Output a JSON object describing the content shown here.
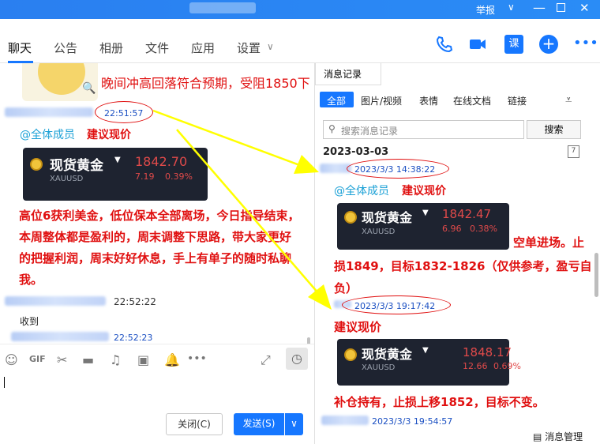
{
  "window": {
    "title": "",
    "report_label": "举报"
  },
  "tabs": [
    "聊天",
    "公告",
    "相册",
    "文件",
    "应用",
    "设置"
  ],
  "chat": {
    "top_caption": "晚间冲高回落符合预期，受阻1850下",
    "msg1_time": "22:51:57",
    "msg1_at": "@全体成员",
    "msg1_title": "建议现价",
    "card1": {
      "name": "现货黄金",
      "code": "XAUUSD",
      "price": "1842.70",
      "change": "7.19",
      "pct": "0.39%"
    },
    "msg1_body": "高位6获利美金，低位保本全部离场，今日指导结束，本周整体都是盈利的，周末调整下思路，带大家更好的把握利润，周末好好休息，手上有单子的随时私聊我。",
    "msg2_time": "22:52:22",
    "msg2_body": "收到",
    "msg3_time": "22:52:23"
  },
  "buttons": {
    "close": "关闭(C)",
    "send": "发送(S)"
  },
  "history": {
    "title": "消息记录",
    "filters": [
      "全部",
      "图片/视频",
      "表情",
      "在线文档",
      "链接"
    ],
    "search_placeholder": "搜索消息记录",
    "search_button": "搜索",
    "date": "2023-03-03",
    "entry1_time": "2023/3/3 14:38:22",
    "entry1_at": "@全体成员",
    "entry1_title": "建议现价",
    "card2": {
      "name": "现货黄金",
      "code": "XAUUSD",
      "price": "1842.47",
      "change": "6.96",
      "pct": "0.38%"
    },
    "entry1_body_a": "空单进场。止",
    "entry1_body_b": "损1849，目标1832-1826（仅供参考，盈亏自负）",
    "entry2_time": "2023/3/3 19:17:42",
    "entry2_title": "建议现价",
    "card3": {
      "name": "现货黄金",
      "code": "XAUUSD",
      "price": "1848.17",
      "change": "12.66",
      "pct": "0.69%"
    },
    "entry2_body": "补仓持有，止损上移1852，目标不变。",
    "entry3_time": "2023/3/3 19:54:57",
    "manage_label": "消息管理"
  },
  "colors": {
    "accent": "#1677ff",
    "annotation": "#e01010",
    "arrow": "#ffff00"
  }
}
